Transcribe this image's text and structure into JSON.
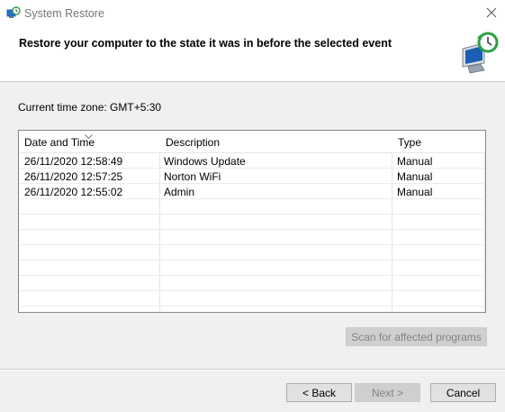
{
  "window": {
    "title": "System Restore"
  },
  "header": {
    "heading": "Restore your computer to the state it was in before the selected event"
  },
  "timezone_label": "Current time zone: GMT+5:30",
  "table": {
    "columns": [
      "Date and Time",
      "Description",
      "Type"
    ],
    "sorted_column": "Date and Time",
    "rows": [
      {
        "date": "26/11/2020 12:58:49",
        "description": "Windows Update",
        "type": "Manual"
      },
      {
        "date": "26/11/2020 12:57:25",
        "description": "Norton WiFi",
        "type": "Manual"
      },
      {
        "date": "26/11/2020 12:55:02",
        "description": "Admin",
        "type": "Manual"
      }
    ]
  },
  "buttons": {
    "scan": "Scan for affected programs",
    "back": "< Back",
    "next": "Next >",
    "cancel": "Cancel"
  },
  "button_states": {
    "scan": "disabled",
    "next": "disabled"
  },
  "icons": {
    "app": "system-restore-icon",
    "close": "close-icon",
    "sort": "chevron-down-icon",
    "header": "computer-restore-clock-icon"
  },
  "colors": {
    "disabled_text": "#838383",
    "accent_blue": "#1a5fb4",
    "restore_green": "#2ea043"
  }
}
